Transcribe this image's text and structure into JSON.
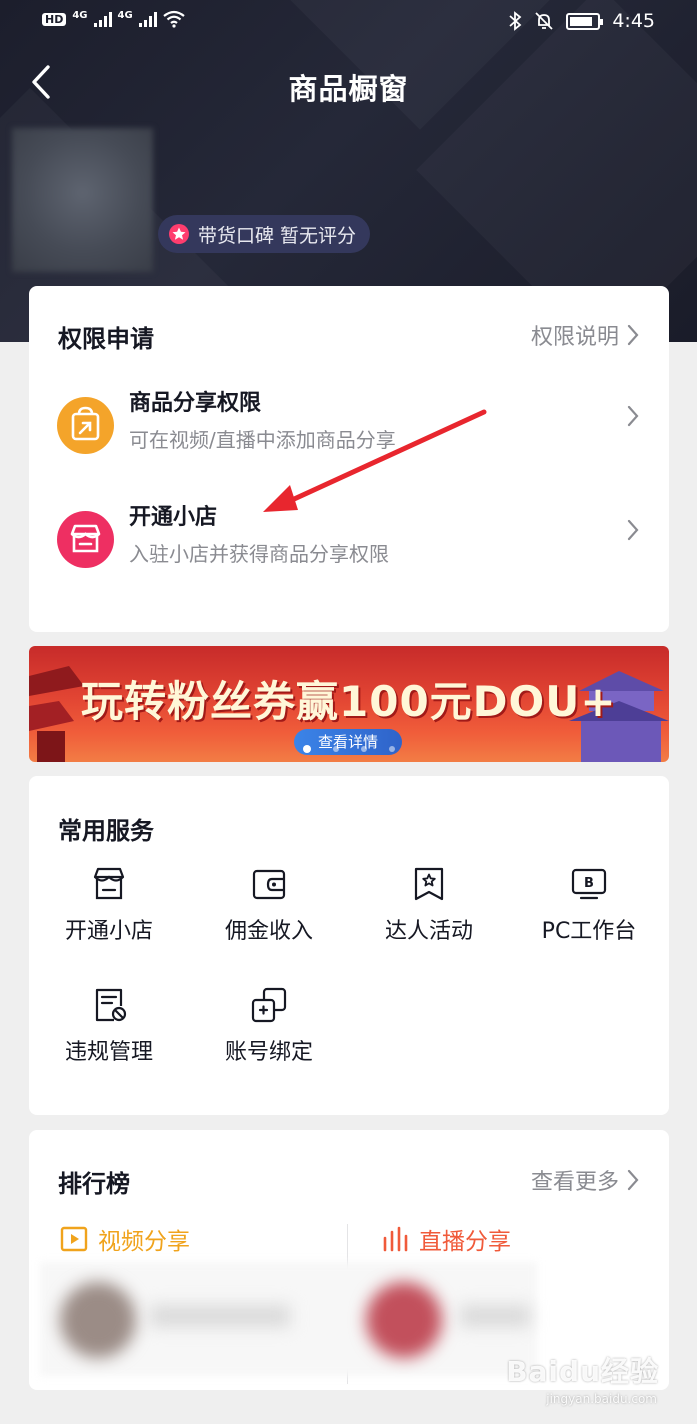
{
  "status_bar": {
    "hd": "HD",
    "network_1": "4G",
    "network_2": "4G",
    "time": "4:45"
  },
  "nav": {
    "title": "商品橱窗"
  },
  "profile": {
    "reputation_label": "带货口碑 暂无评分"
  },
  "permissions": {
    "title": "权限申请",
    "link": "权限说明",
    "items": [
      {
        "name": "商品分享权限",
        "desc": "可在视频/直播中添加商品分享",
        "icon": "share-bag-icon",
        "color": "#f4a42a"
      },
      {
        "name": "开通小店",
        "desc": "入驻小店并获得商品分享权限",
        "icon": "shop-icon",
        "color": "#ee2f62"
      }
    ]
  },
  "banner": {
    "text": "玩转粉丝券赢100元DOU+",
    "button": "查看详情"
  },
  "services": {
    "title": "常用服务",
    "items": [
      {
        "label": "开通小店",
        "icon": "shop-icon"
      },
      {
        "label": "佣金收入",
        "icon": "wallet-icon"
      },
      {
        "label": "达人活动",
        "icon": "star-bookmark-icon"
      },
      {
        "label": "PC工作台",
        "icon": "pc-monitor-icon"
      },
      {
        "label": "违规管理",
        "icon": "violation-doc-icon"
      },
      {
        "label": "账号绑定",
        "icon": "account-link-icon"
      }
    ]
  },
  "ranking": {
    "title": "排行榜",
    "link": "查看更多",
    "tabs": [
      {
        "label": "视频分享",
        "icon": "video-play-icon",
        "color": "#f0a31c"
      },
      {
        "label": "直播分享",
        "icon": "live-bars-icon",
        "color": "#f05a3a"
      }
    ]
  },
  "watermark": {
    "text": "Baidu经验",
    "sub": "jingyan.baidu.com"
  },
  "colors": {
    "hero_bg": "#1c1e2c",
    "page_bg": "#efefef",
    "annotation_arrow": "#e8262e"
  }
}
